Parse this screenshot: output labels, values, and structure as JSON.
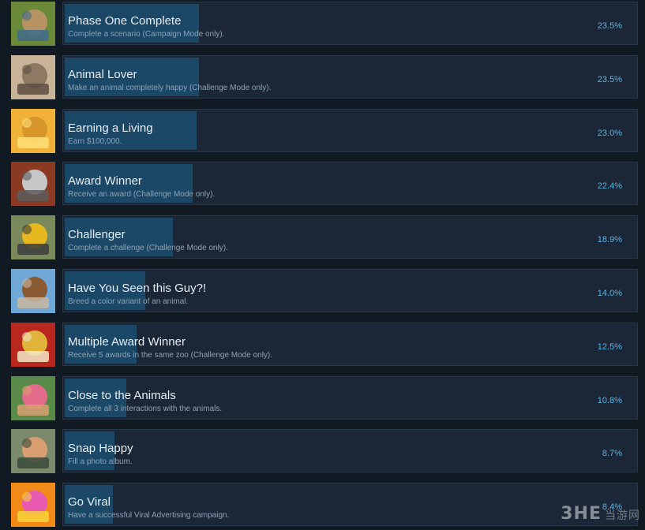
{
  "achievements": [
    {
      "name": "Phase One Complete",
      "description": "Complete a scenario (Campaign Mode only).",
      "percent_label": "23.5%",
      "percent": 23.5,
      "icon": "zoo-map-icon",
      "colors": [
        "#6a8a3a",
        "#b79363",
        "#3f6b8c"
      ]
    },
    {
      "name": "Animal Lover",
      "description": "Make an animal completely happy (Challenge Mode only).",
      "percent_label": "23.5%",
      "percent": 23.5,
      "icon": "elephant-icon",
      "colors": [
        "#c9b49a",
        "#8e7a64",
        "#5d4c3e"
      ]
    },
    {
      "name": "Earning a Living",
      "description": "Earn $100,000.",
      "percent_label": "23.0%",
      "percent": 23.0,
      "icon": "gold-bars-icon",
      "colors": [
        "#f0b238",
        "#d8952a",
        "#ffe17a"
      ]
    },
    {
      "name": "Award Winner",
      "description": "Receive an award (Challenge Mode only).",
      "percent_label": "22.4%",
      "percent": 22.4,
      "icon": "trophy-icon",
      "colors": [
        "#8a3a22",
        "#c7c7c7",
        "#5a5a5a"
      ]
    },
    {
      "name": "Challenger",
      "description": "Complete a challenge (Challenge Mode only).",
      "percent_label": "18.9%",
      "percent": 18.9,
      "icon": "yellow-cart-icon",
      "colors": [
        "#7a8a5a",
        "#e8b820",
        "#3c3c3c"
      ]
    },
    {
      "name": "Have You Seen this Guy?!",
      "description": "Breed a color variant of an animal.",
      "percent_label": "14.0%",
      "percent": 14.0,
      "icon": "bears-icon",
      "colors": [
        "#6fa8d6",
        "#8a5a32",
        "#c9b8a0"
      ]
    },
    {
      "name": "Multiple Award Winner",
      "description": "Receive 5 awards in the same zoo (Challenge Mode only).",
      "percent_label": "12.5%",
      "percent": 12.5,
      "icon": "gold-medals-icon",
      "colors": [
        "#b8281e",
        "#e0b43a",
        "#f2e8c8"
      ]
    },
    {
      "name": "Close to the Animals",
      "description": "Complete all 3 interactions with the animals.",
      "percent_label": "10.8%",
      "percent": 10.8,
      "icon": "zookeeper-icon",
      "colors": [
        "#5a8a4a",
        "#e26a8a",
        "#d8a070"
      ]
    },
    {
      "name": "Snap Happy",
      "description": "Fill a photo album.",
      "percent_label": "8.7%",
      "percent": 8.7,
      "icon": "photographer-icon",
      "colors": [
        "#7a8a6a",
        "#d8a070",
        "#3a4a3a"
      ]
    },
    {
      "name": "Go Viral",
      "description": "Have a successful Viral Advertising campaign.",
      "percent_label": "8.4%",
      "percent": 8.4,
      "icon": "viral-ad-icon",
      "colors": [
        "#f28a1a",
        "#e85ab0",
        "#f6d23a"
      ]
    }
  ],
  "watermark": {
    "brand": "3HE",
    "site": "当游网"
  }
}
